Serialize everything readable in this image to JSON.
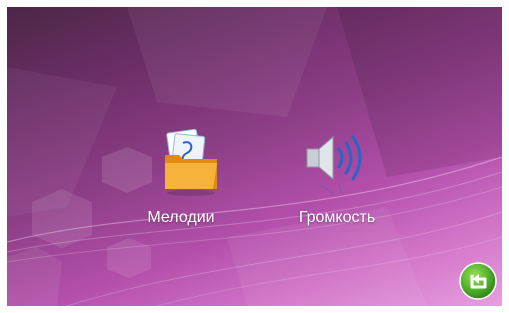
{
  "menu": {
    "items": [
      {
        "label": "Мелодии",
        "icon": "music-folder-icon"
      },
      {
        "label": "Громкость",
        "icon": "speaker-volume-icon"
      }
    ]
  },
  "navigation": {
    "back_icon": "return-arrow-icon"
  },
  "colors": {
    "background_dark": "#4b2746",
    "background_mid": "#8d3e86",
    "background_light": "#e89ee0",
    "back_button": "#4fae2a",
    "folder": "#f2a21c",
    "speaker_waves": "#2b63c9"
  }
}
